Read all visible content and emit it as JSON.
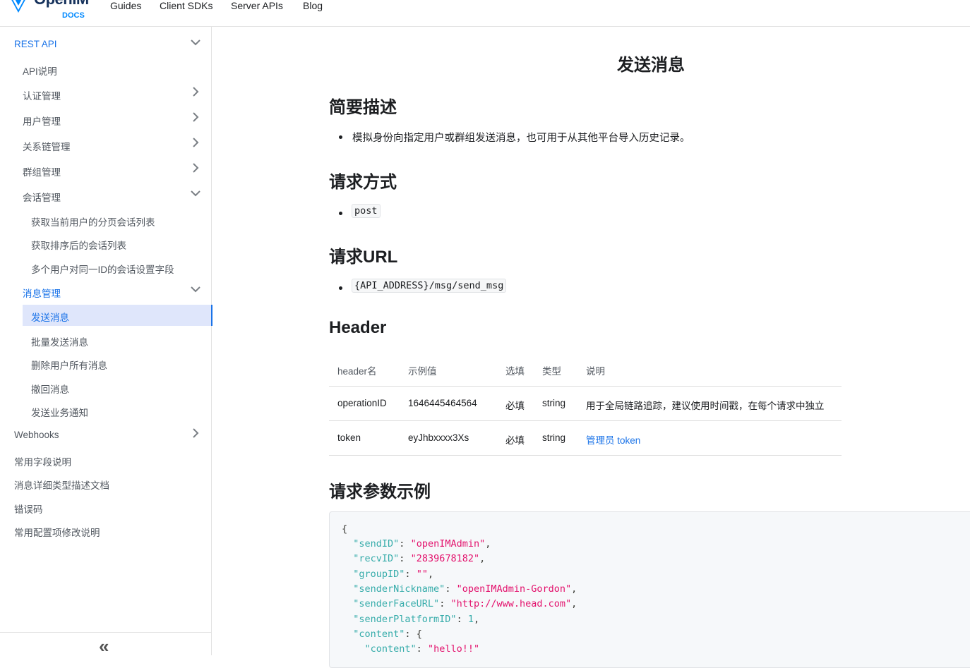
{
  "navbar": {
    "brand_name": "OpenIM",
    "brand_sub": "DOCS",
    "links": [
      "Guides",
      "Client SDKs",
      "Server APIs",
      "Blog"
    ]
  },
  "sidebar": {
    "items": [
      {
        "label": "REST API",
        "level": 0,
        "caret": "down",
        "color": "blue"
      },
      {
        "label": "API说明",
        "level": 1
      },
      {
        "label": "认证管理",
        "level": 1,
        "caret": "right"
      },
      {
        "label": "用户管理",
        "level": 1,
        "caret": "right"
      },
      {
        "label": "关系链管理",
        "level": 1,
        "caret": "right"
      },
      {
        "label": "群组管理",
        "level": 1,
        "caret": "right"
      },
      {
        "label": "会话管理",
        "level": 1,
        "caret": "down"
      },
      {
        "label": "获取当前用户的分页会话列表",
        "level": 2
      },
      {
        "label": "获取排序后的会话列表",
        "level": 2
      },
      {
        "label": "多个用户对同一ID的会话设置字段",
        "level": 2
      },
      {
        "label": "消息管理",
        "level": 1,
        "caret": "down",
        "color": "blue"
      },
      {
        "label": "发送消息",
        "level": 2,
        "active": true
      },
      {
        "label": "批量发送消息",
        "level": 2
      },
      {
        "label": "删除用户所有消息",
        "level": 2
      },
      {
        "label": "撤回消息",
        "level": 2
      },
      {
        "label": "发送业务通知",
        "level": 2
      },
      {
        "label": "Webhooks",
        "level": 0,
        "caret": "right"
      },
      {
        "label": "常用字段说明",
        "level": 0
      },
      {
        "label": "消息详细类型描述文档",
        "level": 0
      },
      {
        "label": "错误码",
        "level": 0
      },
      {
        "label": "常用配置项修改说明",
        "level": 0
      }
    ],
    "collapse_icon": "«"
  },
  "main": {
    "title": "发送消息",
    "sections": {
      "desc_heading": "简要描述",
      "desc_text": "模拟身份向指定用户或群组发送消息，也可用于从其他平台导入历史记录。",
      "method_heading": "请求方式",
      "method_value": "post",
      "url_heading": "请求URL",
      "url_value": "{API_ADDRESS}/msg/send_msg",
      "header_heading": "Header",
      "example_heading": "请求参数示例"
    },
    "table": {
      "columns": [
        "header名",
        "示例值",
        "选填",
        "类型",
        "说明"
      ],
      "rows": [
        [
          "operationID",
          "1646445464564",
          "必填",
          "string",
          "用于全局链路追踪，建议使用时间戳，在每个请求中独立"
        ],
        [
          "token",
          "eyJhbxxxx3Xs",
          "必填",
          "string",
          "管理员 token"
        ]
      ]
    },
    "code": {
      "open": "{",
      "lines": [
        {
          "key": "\"sendID\"",
          "value": "\"openIMAdmin\"",
          "type": "s",
          "tail": ","
        },
        {
          "key": "\"recvID\"",
          "value": "\"2839678182\"",
          "type": "s",
          "tail": ","
        },
        {
          "key": "\"groupID\"",
          "value": "\"\"",
          "type": "s",
          "tail": ","
        },
        {
          "key": "\"senderNickname\"",
          "value": "\"openIMAdmin-Gordon\"",
          "type": "s",
          "tail": ","
        },
        {
          "key": "\"senderFaceURL\"",
          "value": "\"http://www.head.com\"",
          "type": "s",
          "tail": ","
        },
        {
          "key": "\"senderPlatformID\"",
          "value": "1",
          "type": "n",
          "tail": ","
        },
        {
          "key": "\"content\"",
          "value": "{",
          "type": "p",
          "tail": ""
        },
        {
          "key": "\"content\"",
          "value": "\"hello!!\"",
          "type": "s",
          "tail": ""
        }
      ]
    }
  },
  "colors": {
    "accent": "#1a73e8",
    "active_bg": "#dfe6fb"
  }
}
